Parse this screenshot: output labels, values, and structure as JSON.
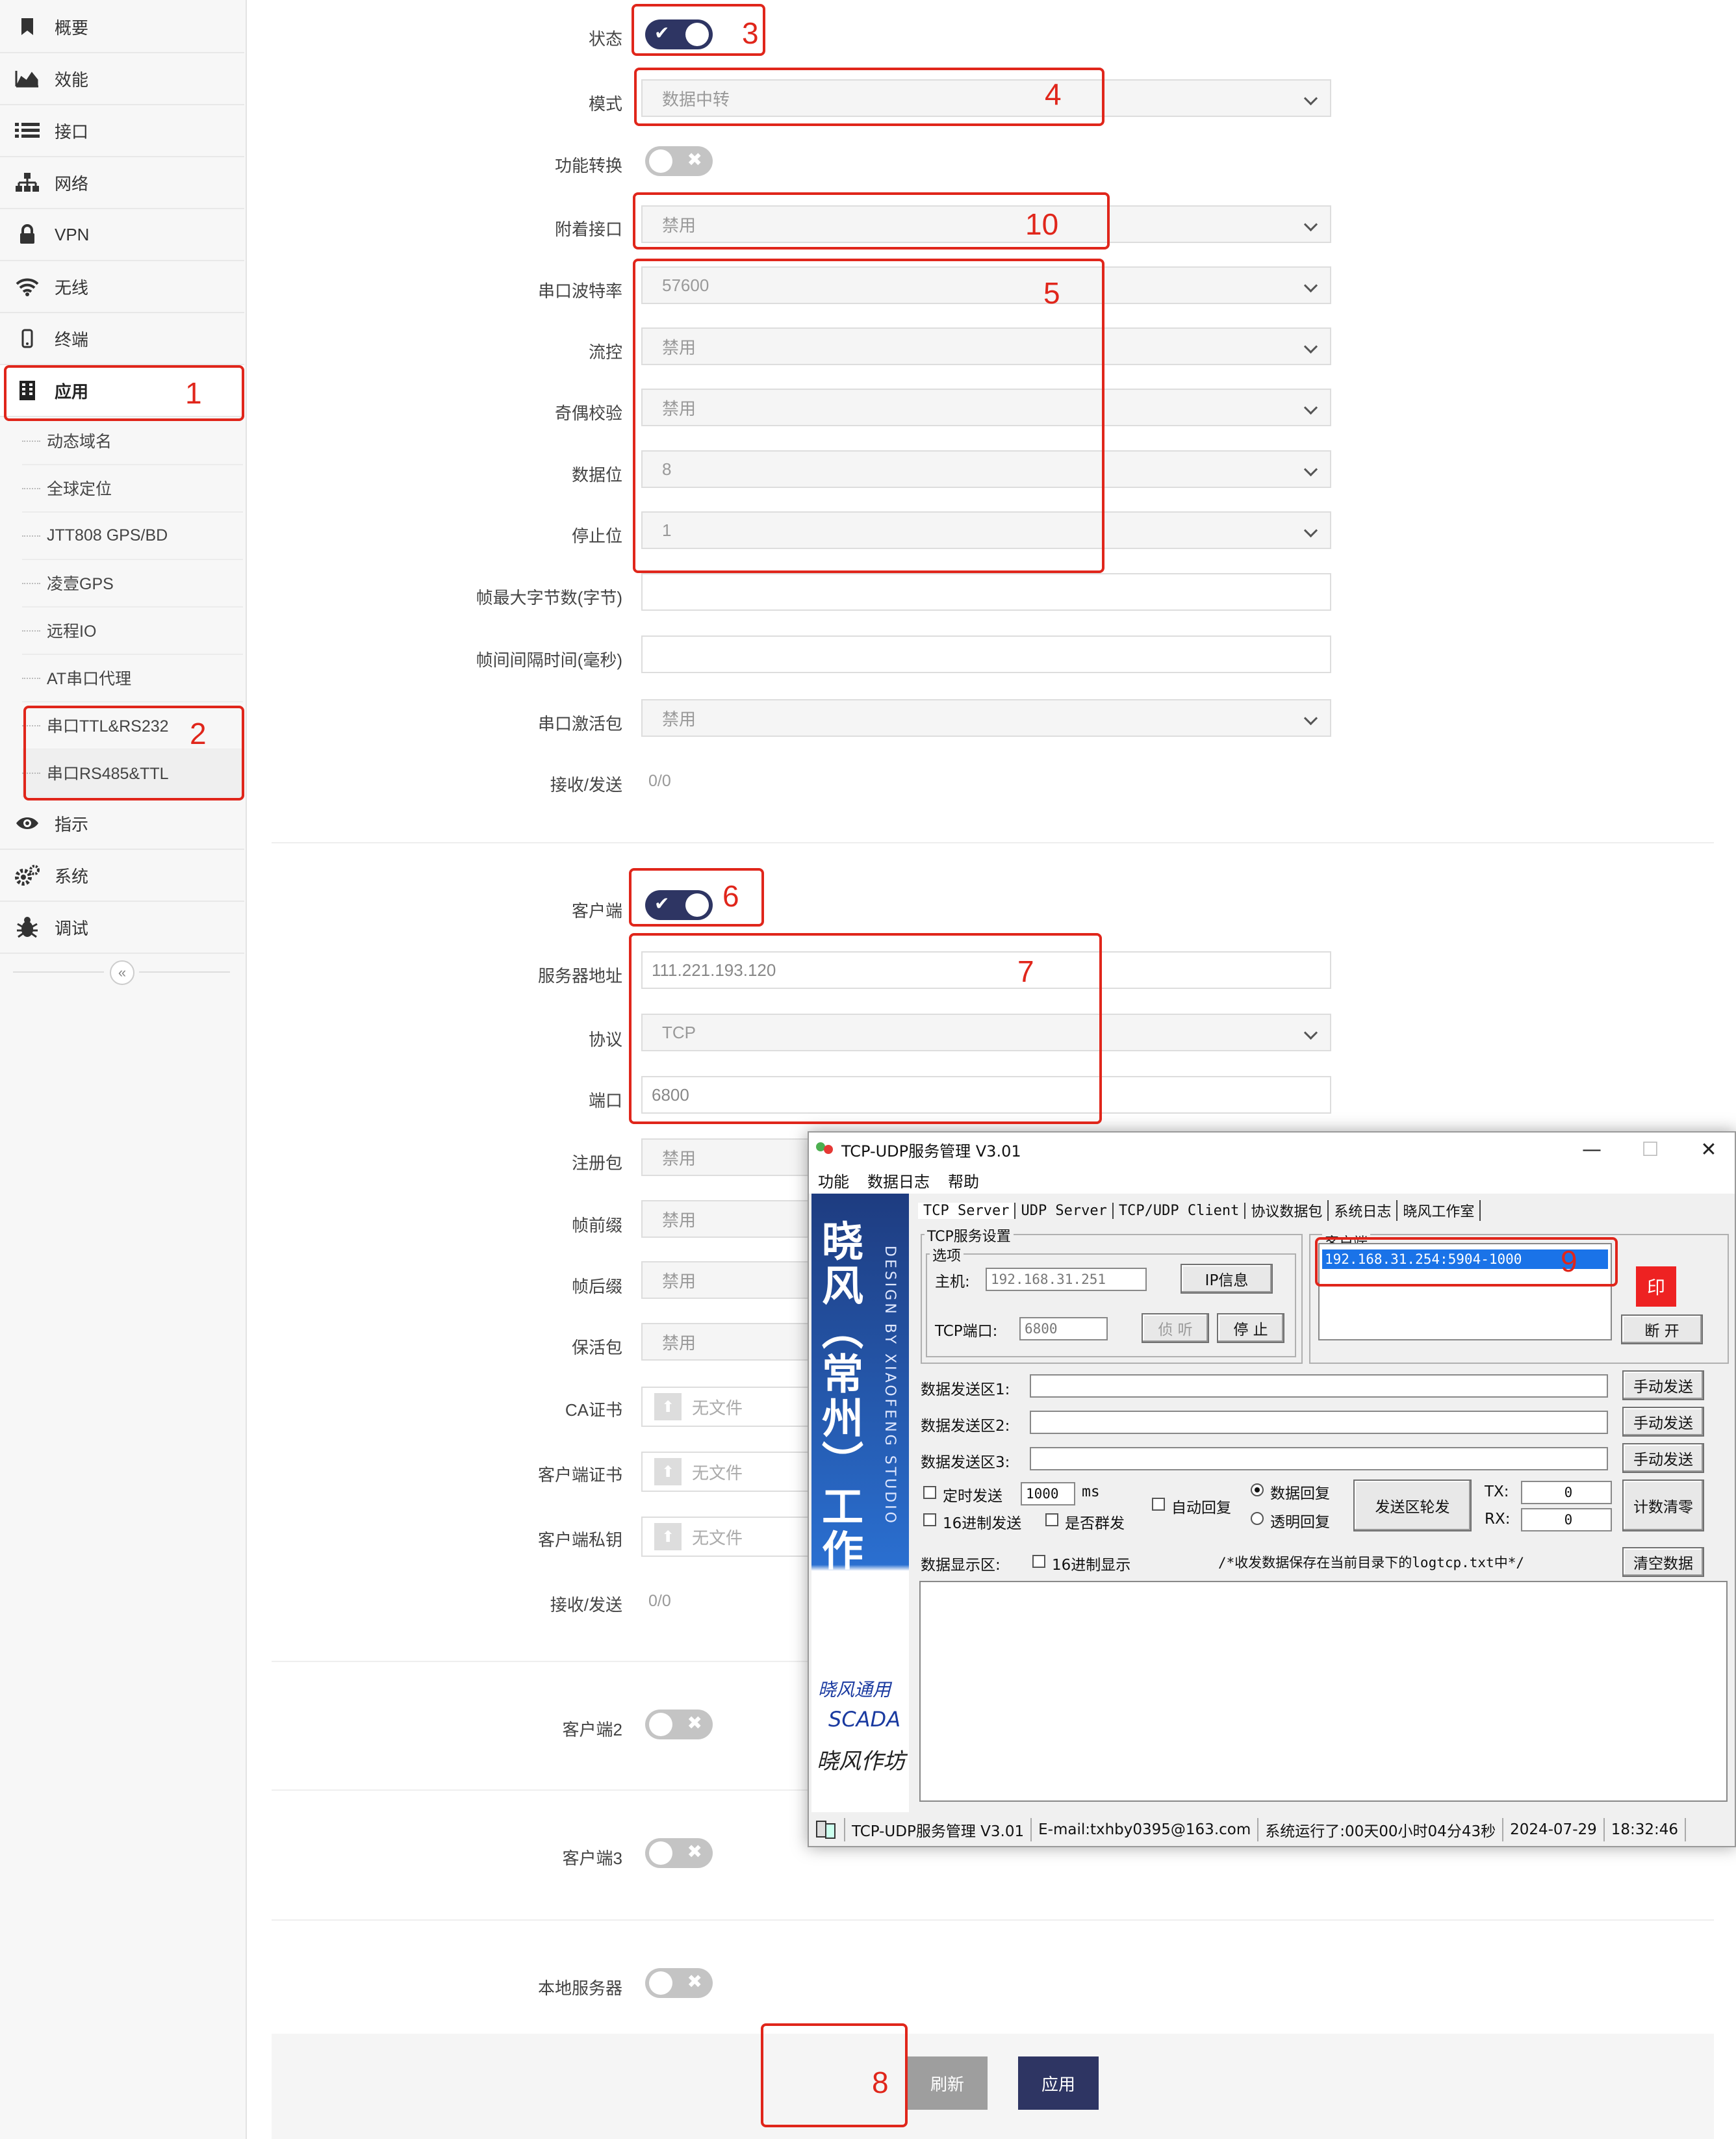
{
  "sidebar": {
    "items": [
      {
        "label": "概要",
        "icon": "bookmark-icon"
      },
      {
        "label": "效能",
        "icon": "area-chart-icon"
      },
      {
        "label": "接口",
        "icon": "list-icon"
      },
      {
        "label": "网络",
        "icon": "sitemap-icon"
      },
      {
        "label": "VPN",
        "icon": "lock-icon"
      },
      {
        "label": "无线",
        "icon": "wifi-icon"
      },
      {
        "label": "终端",
        "icon": "mobile-icon"
      },
      {
        "label": "应用",
        "icon": "building-icon"
      }
    ],
    "sub_items": [
      {
        "label": "动态域名"
      },
      {
        "label": "全球定位"
      },
      {
        "label": "JTT808 GPS/BD"
      },
      {
        "label": "凌壹GPS"
      },
      {
        "label": "远程IO"
      },
      {
        "label": "AT串口代理"
      },
      {
        "label": "串口TTL&RS232"
      },
      {
        "label": "串口RS485&TTL"
      }
    ],
    "bottom_items": [
      {
        "label": "指示",
        "icon": "eye-icon"
      },
      {
        "label": "系统",
        "icon": "cogs-icon"
      },
      {
        "label": "调试",
        "icon": "bug-icon"
      }
    ],
    "collapse_glyph": "«"
  },
  "form": {
    "status_label": "状态",
    "mode_label": "模式",
    "mode_value": "数据中转",
    "func_switch_label": "功能转换",
    "attach_label": "附着接口",
    "attach_value": "禁用",
    "baud_label": "串口波特率",
    "baud_value": "57600",
    "flow_label": "流控",
    "flow_value": "禁用",
    "parity_label": "奇偶校验",
    "parity_value": "禁用",
    "databits_label": "数据位",
    "databits_value": "8",
    "stopbits_label": "停止位",
    "stopbits_value": "1",
    "frame_max_label": "帧最大字节数(字节)",
    "frame_interval_label": "帧间间隔时间(毫秒)",
    "activate_label": "串口激活包",
    "activate_value": "禁用",
    "rxtx_label": "接收/发送",
    "rxtx_value": "0/0",
    "client_label": "客户端",
    "server_label": "服务器地址",
    "server_value": "111.221.193.120",
    "protocol_label": "协议",
    "protocol_value": "TCP",
    "port_label": "端口",
    "port_value": "6800",
    "reg_label": "注册包",
    "reg_value": "禁用",
    "prefix_label": "帧前缀",
    "prefix_value": "禁用",
    "suffix_label": "帧后缀",
    "suffix_value": "禁用",
    "keepalive_label": "保活包",
    "keepalive_value": "禁用",
    "ca_label": "CA证书",
    "client_cert_label": "客户端证书",
    "client_key_label": "客户端私钥",
    "no_file": "无文件",
    "rxtx2_label": "接收/发送",
    "rxtx2_value": "0/0",
    "client2_label": "客户端2",
    "client3_label": "客户端3",
    "local_server_label": "本地服务器",
    "refresh_btn": "刷新",
    "apply_btn": "应用"
  },
  "annotations": [
    "1",
    "2",
    "3",
    "4",
    "5",
    "6",
    "7",
    "8",
    "9",
    "10"
  ],
  "tool_window": {
    "title": "TCP-UDP服务管理 V3.01",
    "menu": [
      "功能",
      "数据日志",
      "帮助"
    ],
    "tabs": [
      "TCP Server",
      "UDP Server",
      "TCP/UDP Client",
      "协议数据包",
      "系统日志",
      "晓风工作室"
    ],
    "banner_title": "晓风（常州）工作室",
    "banner_sub": "DESIGN BY XIAOFENG STUDIO",
    "banner_sc1": "晓风通用",
    "banner_sc2": "SCADA",
    "banner_sc3": "晓风作坊",
    "group_tcp": "TCP服务设置",
    "group_opts": "选项",
    "host_label": "主机:",
    "host_value": "192.168.31.251",
    "ipinfo_btn": "IP信息",
    "tcpport_label": "TCP端口:",
    "tcpport_value": "6800",
    "listen_btn": "侦 听",
    "stop_btn": "停 止",
    "clients_label": "客户端",
    "client_entry": "192.168.31.254:5904-1000",
    "disconnect_btn": "断 开",
    "send1_label": "数据发送区1:",
    "send2_label": "数据发送区2:",
    "send3_label": "数据发送区3:",
    "manual_send": "手动发送",
    "timed_send": "定时发送",
    "timed_value": "1000",
    "ms_label": "ms",
    "hex_send": "16进制发送",
    "broadcast": "是否群发",
    "auto_reply": "自动回复",
    "data_reply": "数据回复",
    "transparent_reply": "透明回复",
    "rotate_btn": "发送区轮发",
    "tx_label": "TX:",
    "tx_value": "0",
    "rx_label": "RX:",
    "rx_value": "0",
    "count_clear": "计数清零",
    "display_label": "数据显示区:",
    "hex_display": "16进制显示",
    "save_note": "/*收发数据保存在当前目录下的logtcp.txt中*/",
    "clear_btn": "清空数据",
    "status_app": "TCP-UDP服务管理 V3.01",
    "status_email": "E-mail:txhby0395@163.com",
    "status_runtime": "系统运行了:00天00小时04分43秒",
    "status_date": "2024-07-29",
    "status_time": "18:32:46",
    "min_glyph": "—",
    "max_glyph": "☐",
    "close_glyph": "✕"
  },
  "colors": {
    "accent": "#2e3563",
    "annotation": "#e0261b",
    "toggle_off": "#c4c4c4",
    "list_selected": "#1a73e8"
  }
}
